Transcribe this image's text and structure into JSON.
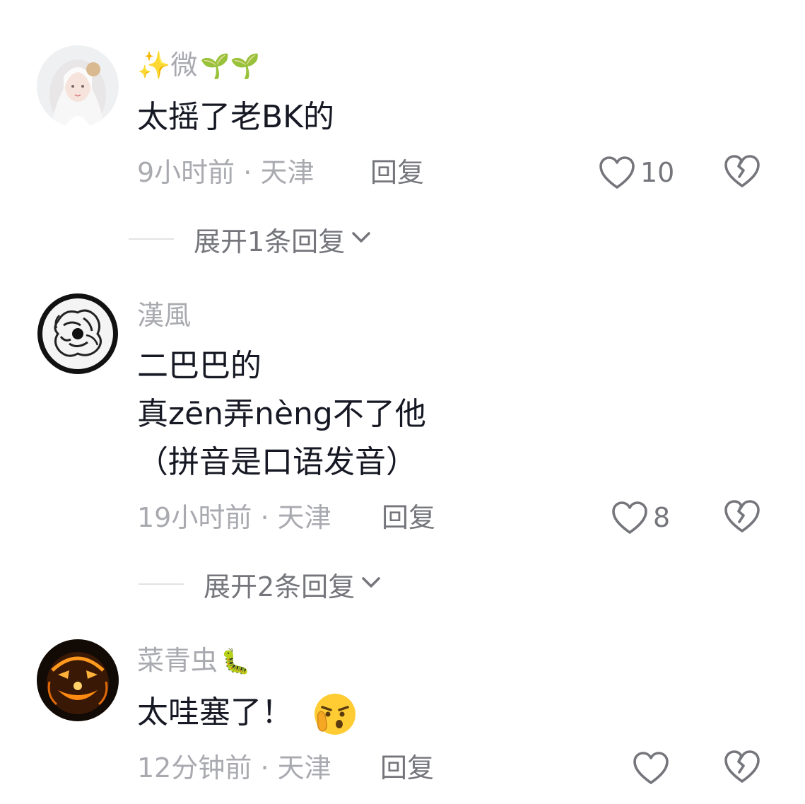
{
  "comments": [
    {
      "username": "✨微",
      "username_emoji": "🌱🌱",
      "text_lines": [
        "太摇了老BK的"
      ],
      "time": "9小时前",
      "location": "天津",
      "separator": "·",
      "reply_label": "回复",
      "likes": "10",
      "expand_label": "展开1条回复"
    },
    {
      "username": "漢風",
      "username_emoji": "",
      "text_lines": [
        "二巴巴的",
        "真zēn弄nèng不了他",
        "（拼音是口语发音）"
      ],
      "time": "19小时前",
      "location": "天津",
      "separator": "·",
      "reply_label": "回复",
      "likes": "8",
      "expand_label": "展开2条回复"
    },
    {
      "username": "菜青虫",
      "username_emoji": "🐛",
      "text_lines": [
        "太哇塞了！"
      ],
      "text_emoji": "🤫",
      "time": "12分钟前",
      "location": "天津",
      "separator": "·",
      "reply_label": "回复",
      "likes": ""
    }
  ],
  "icons": {
    "like": "heart-outline-icon",
    "dislike": "broken-heart-outline-icon",
    "expand": "chevron-down-icon"
  },
  "colors": {
    "text": "#161823",
    "secondary": "#a9aab0",
    "action": "#75767c"
  }
}
